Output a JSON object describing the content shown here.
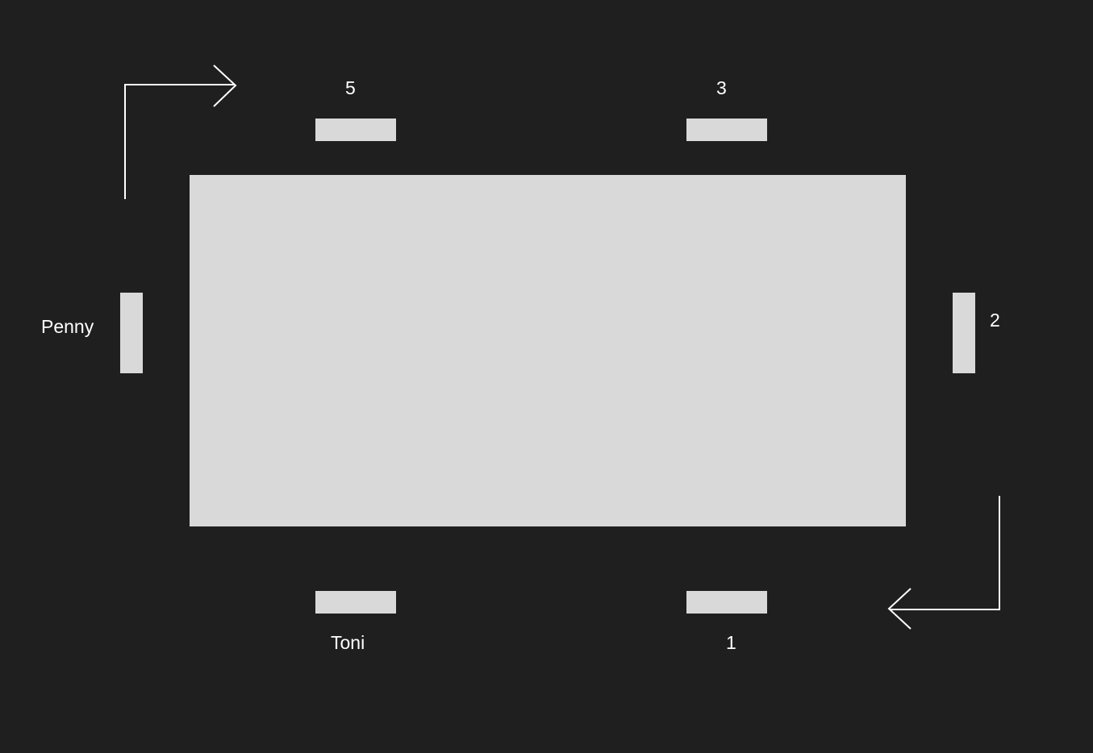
{
  "colors": {
    "background": "#1f1f1f",
    "table": "#d9d9d9",
    "chair": "#d9d9d9",
    "text": "#ffffff",
    "arrow": "#ffffff"
  },
  "labels": {
    "top_left_chair": "5",
    "top_right_chair": "3",
    "right_chair": "2",
    "bottom_right_chair": "1",
    "bottom_left_chair": "Toni",
    "left_chair": "Penny"
  }
}
